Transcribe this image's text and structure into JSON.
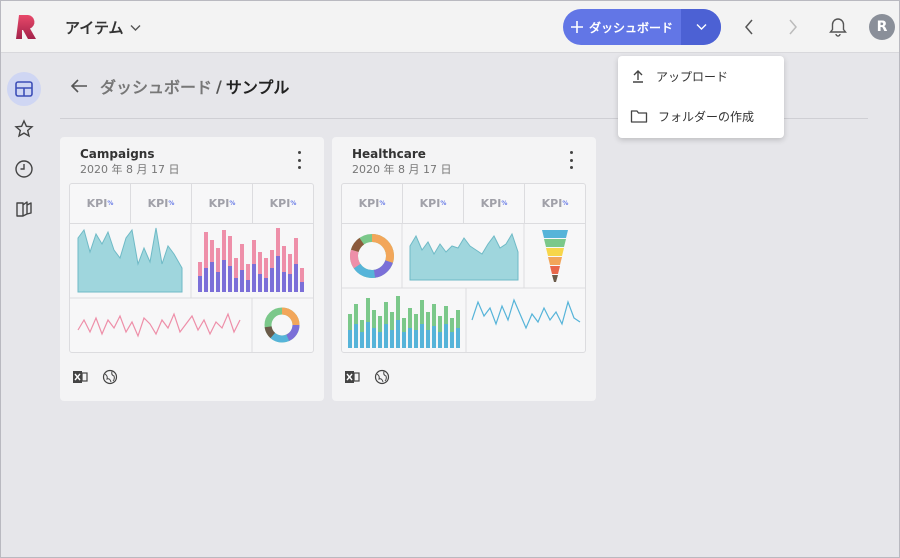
{
  "header": {
    "workspace_label": "アイテム",
    "dashboard_button_label": "ダッシュボード",
    "avatar_initial": "R"
  },
  "breadcrumb": {
    "parent": "ダッシュボード",
    "separator": "/",
    "current": "サンプル"
  },
  "dropdown_menu": {
    "items": [
      {
        "label": "アップロード",
        "icon": "upload-icon"
      },
      {
        "label": "フォルダーの作成",
        "icon": "folder-icon"
      }
    ]
  },
  "cards": [
    {
      "title": "Campaigns",
      "date": "2020 年 8 月 17 日",
      "kpis": [
        "KPI",
        "KPI",
        "KPI",
        "KPI"
      ],
      "kpi_suffix": "%"
    },
    {
      "title": "Healthcare",
      "date": "2020 年 8 月 17 日",
      "kpis": [
        "KPI",
        "KPI",
        "KPI",
        "KPI"
      ],
      "kpi_suffix": "%"
    }
  ],
  "colors": {
    "accent": "#6276e6",
    "accent_dark": "#4c61d4",
    "teal_area": "#9fd6dd",
    "pink": "#ee8fa9",
    "purple": "#7b6fd8",
    "green": "#7bc88a",
    "blue": "#56b4d9"
  },
  "icons": [
    "logo-icon",
    "chevron-down-icon",
    "plus-icon",
    "chevron-left-icon",
    "chevron-right-icon",
    "bell-icon",
    "dashboard-icon",
    "star-icon",
    "clock-icon",
    "library-icon",
    "back-arrow-icon",
    "more-vertical-icon",
    "excel-icon",
    "globe-icon"
  ]
}
